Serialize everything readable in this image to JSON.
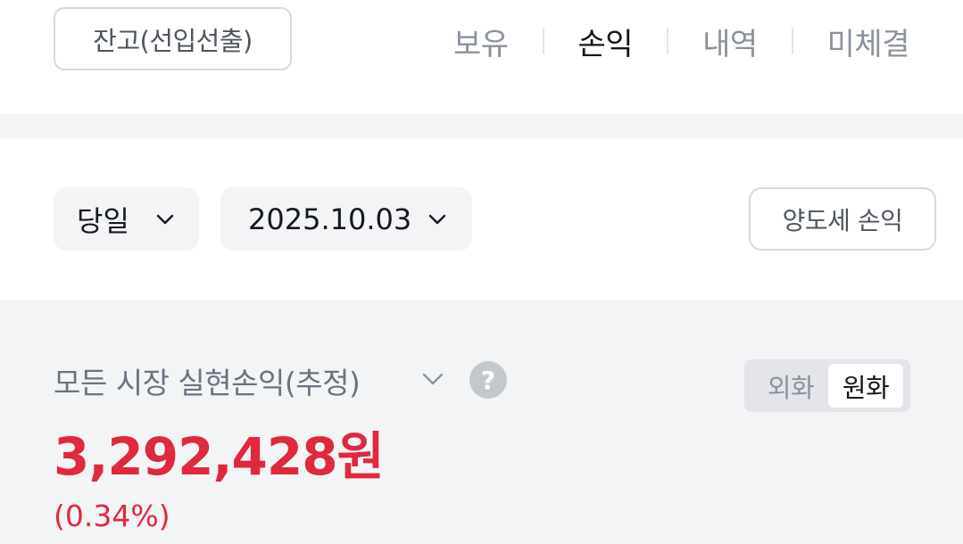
{
  "header": {
    "balance_button": "잔고(선입선출)",
    "tabs": [
      {
        "label": "보유",
        "active": false
      },
      {
        "label": "손익",
        "active": true
      },
      {
        "label": "내역",
        "active": false
      },
      {
        "label": "미체결",
        "active": false
      }
    ]
  },
  "filters": {
    "period": "당일",
    "date": "2025.10.03",
    "tax_button": "양도세 손익"
  },
  "summary": {
    "title": "모든 시장 실현손익(추정)",
    "help_icon": "question-mark",
    "currency_options": [
      "외화",
      "원화"
    ],
    "selected_currency": "원화",
    "amount": "3,292,428원",
    "percent": "(0.34%)",
    "profit_color": "#e0283f"
  }
}
